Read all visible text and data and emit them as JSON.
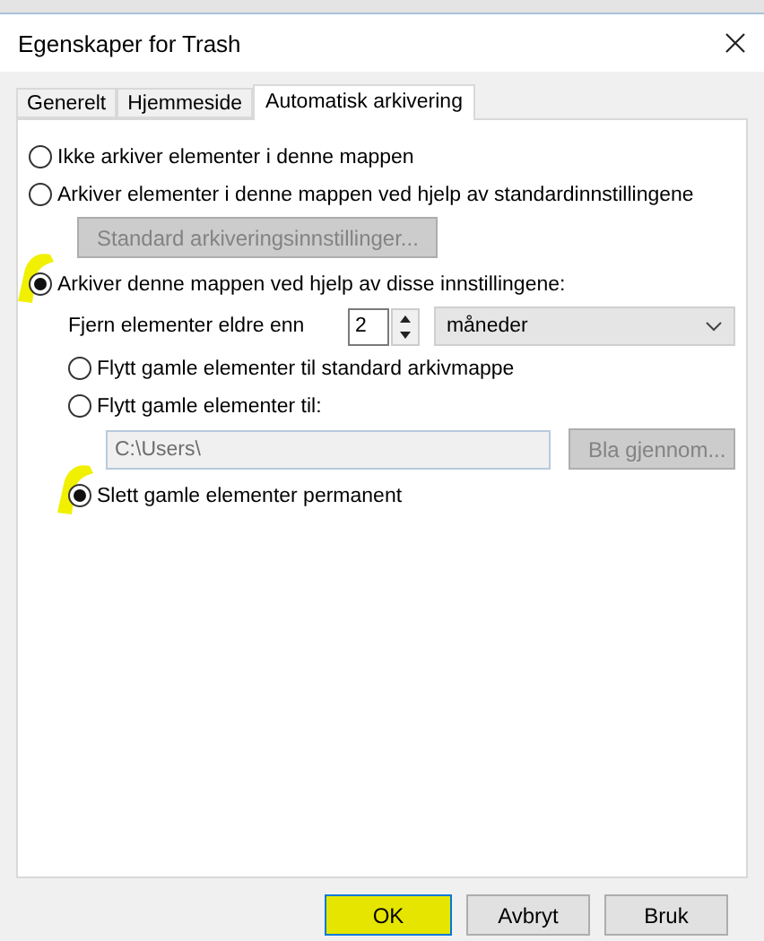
{
  "window": {
    "title": "Egenskaper for Trash"
  },
  "tabs": [
    {
      "label": "Generelt",
      "selected": false
    },
    {
      "label": "Hjemmeside",
      "selected": false
    },
    {
      "label": "Automatisk arkivering",
      "selected": true
    }
  ],
  "archive_modes": [
    {
      "label": "Ikke arkiver elementer i denne mappen",
      "selected": false,
      "highlighted": false
    },
    {
      "label": "Arkiver elementer i denne mappen ved hjelp av standardinnstillingene",
      "selected": false,
      "highlighted": false,
      "button": {
        "label": "Standard arkiveringsinnstillinger...",
        "disabled": true
      }
    },
    {
      "label": "Arkiver denne mappen ved hjelp av disse innstillingene:",
      "selected": true,
      "highlighted": true
    }
  ],
  "age": {
    "label": "Fjern elementer eldre enn",
    "value": "2",
    "unit": "måneder"
  },
  "destinations": [
    {
      "label": "Flytt gamle elementer til standard arkivmappe",
      "selected": false,
      "highlighted": false
    },
    {
      "label": "Flytt gamle elementer til:",
      "selected": false,
      "highlighted": false,
      "path": {
        "value": "C:\\Users\\",
        "disabled": true
      },
      "browse": {
        "label": "Bla gjennom...",
        "disabled": true
      }
    },
    {
      "label": "Slett gamle elementer permanent",
      "selected": true,
      "highlighted": true
    }
  ],
  "buttons": [
    {
      "label": "OK",
      "default": true,
      "highlighted": true
    },
    {
      "label": "Avbryt",
      "default": false,
      "highlighted": false
    },
    {
      "label": "Bruk",
      "default": false,
      "highlighted": false
    }
  ]
}
